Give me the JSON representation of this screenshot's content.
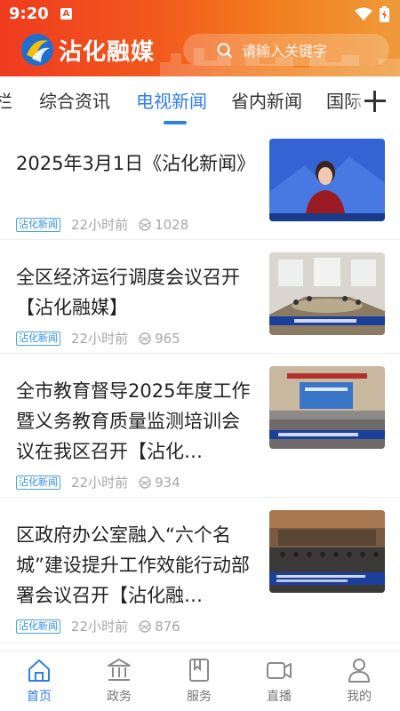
{
  "status_bar": {
    "time": "9:20",
    "notification_letter": "A"
  },
  "header": {
    "logo_text": "沾化融媒",
    "search_placeholder": "请输入关键字",
    "brand_color": "#ef4a22"
  },
  "tabs": [
    {
      "label": "栏"
    },
    {
      "label": "综合资讯"
    },
    {
      "label": "电视新闻",
      "active": true
    },
    {
      "label": "省内新闻"
    },
    {
      "label": "国际"
    }
  ],
  "accent_color": "#2f7ee8",
  "news": [
    {
      "title": "2025年3月1日《沾化新闻》",
      "badge": "沾化新闻",
      "time": "22小时前",
      "views": "1028",
      "thumb": "tv-anchor"
    },
    {
      "title": "全区经济运行调度会议召开【沾化融媒】",
      "badge": "沾化新闻",
      "time": "22小时前",
      "views": "965",
      "thumb": "meeting-room"
    },
    {
      "title": "全市教育督导2025年度工作暨义务教育质量监测培训会议在我区召开【沾化…",
      "badge": "沾化新闻",
      "time": "22小时前",
      "views": "934",
      "thumb": "conference-screen"
    },
    {
      "title": "区政府办公室融入“六个名城”建设提升工作效能行动部署会议召开【沾化融…",
      "badge": "沾化新闻",
      "time": "22小时前",
      "views": "876",
      "thumb": "meeting-stage"
    }
  ],
  "bottom_nav": [
    {
      "label": "首页",
      "icon": "home-icon",
      "active": true
    },
    {
      "label": "政务",
      "icon": "government-icon"
    },
    {
      "label": "服务",
      "icon": "service-bookmark-icon"
    },
    {
      "label": "直播",
      "icon": "video-camera-icon"
    },
    {
      "label": "我的",
      "icon": "user-icon"
    }
  ]
}
